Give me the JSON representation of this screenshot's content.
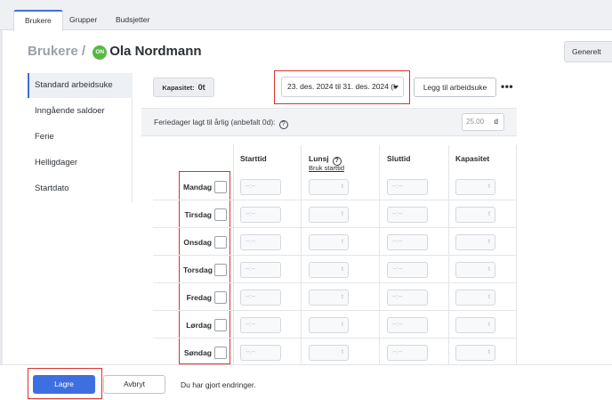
{
  "tabs": [
    "Brukere",
    "Grupper",
    "Budsjetter"
  ],
  "breadcrumb": {
    "parent": "Brukere",
    "separator": "/",
    "badge": "ON",
    "name": "Ola Nordmann"
  },
  "settings_button": "Generelt",
  "sidenav": [
    "Standard arbeidsuke",
    "Inngående saldoer",
    "Ferie",
    "Helligdager",
    "Startdato"
  ],
  "capacity": {
    "label": "Kapasitet:",
    "value": "0t"
  },
  "period": {
    "value": "23. des. 2024 til 31. des. 2024 (l"
  },
  "add_week_button": "Legg til arbeidsuke",
  "more_icon": "more-horizontal-icon",
  "holiday": {
    "label": "Feriedager lagt til årlig (anbefalt 0d):",
    "help": "?",
    "value": "25.00",
    "unit": "d"
  },
  "table": {
    "headers": {
      "start": "Starttid",
      "lunch": "Lunsj",
      "lunch_help": "?",
      "lunch_link": "Bruk starttid",
      "end": "Sluttid",
      "capacity": "Kapasitet"
    },
    "time_placeholder": "--:--",
    "number_placeholder": "t",
    "days": [
      "Mandag",
      "Tirsdag",
      "Onsdag",
      "Torsdag",
      "Fredag",
      "Lørdag",
      "Søndag"
    ]
  },
  "footer": {
    "save": "Lagre",
    "cancel": "Avbryt",
    "status": "Du har gjort endringer."
  },
  "colors": {
    "accent": "#3d6fe0",
    "highlight": "#d9332c",
    "badge": "#57b843"
  }
}
